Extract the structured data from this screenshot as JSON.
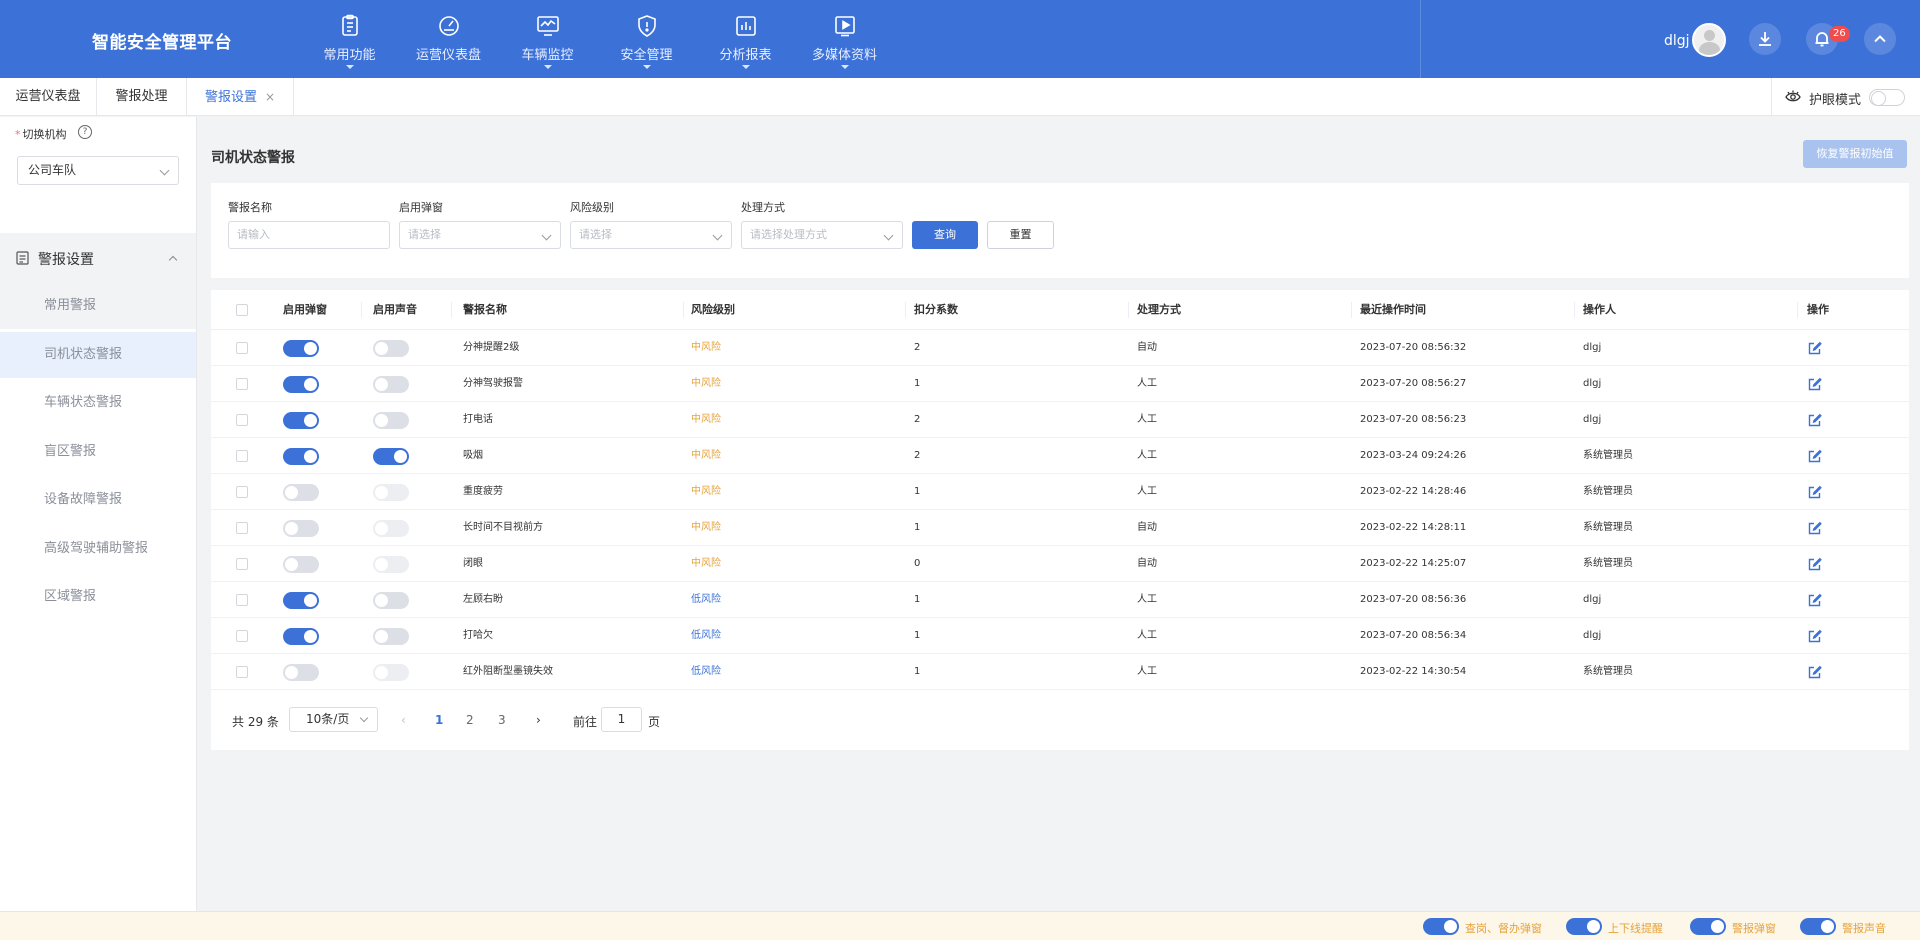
{
  "header": {
    "app_title": "智能安全管理平台",
    "nav": [
      {
        "label": "常用功能",
        "icon": "clipboard-icon",
        "caret": true
      },
      {
        "label": "运营仪表盘",
        "icon": "gauge-icon",
        "caret": false
      },
      {
        "label": "车辆监控",
        "icon": "monitor-icon",
        "caret": true
      },
      {
        "label": "安全管理",
        "icon": "shield-icon",
        "caret": true
      },
      {
        "label": "分析报表",
        "icon": "bar-chart-icon",
        "caret": true
      },
      {
        "label": "多媒体资料",
        "icon": "play-icon",
        "caret": true
      }
    ],
    "user_name": "dlgj",
    "notification_count": "26",
    "colors": {
      "primary": "#3c72d8"
    }
  },
  "tabs": [
    {
      "label": "运营仪表盘"
    },
    {
      "label": "警报处理"
    },
    {
      "label": "警报设置",
      "active": true,
      "close": "×"
    }
  ],
  "eye_mode": {
    "label": "护眼模式",
    "on": false
  },
  "sidebar": {
    "org_label": "切换机构",
    "org_required": "*",
    "help": "?",
    "org_value": "公司车队",
    "group_label": "警报设置",
    "items": [
      {
        "label": "常用警报"
      },
      {
        "label": "司机状态警报"
      },
      {
        "label": "车辆状态警报"
      },
      {
        "label": "盲区警报"
      },
      {
        "label": "设备故障警报"
      },
      {
        "label": "高级驾驶辅助警报"
      },
      {
        "label": "区域警报"
      }
    ]
  },
  "page": {
    "title": "司机状态警报",
    "restore_button": "恢复警报初始值"
  },
  "filters": {
    "fields": [
      {
        "label": "警报名称",
        "placeholder": "请输入"
      },
      {
        "label": "启用弹窗",
        "placeholder": "请选择"
      },
      {
        "label": "风险级别",
        "placeholder": "请选择"
      },
      {
        "label": "处理方式",
        "placeholder": "请选择处理方式"
      }
    ],
    "query_button": "查询",
    "reset_button": "重置"
  },
  "table": {
    "headers": [
      "启用弹窗",
      "启用声音",
      "警报名称",
      "风险级别",
      "扣分系数",
      "处理方式",
      "最近操作时间",
      "操作人",
      "操作"
    ],
    "rows": [
      {
        "popup": "on",
        "sound": "off",
        "name": "分神提醒2级",
        "risk": "中风险",
        "risk_level": "mid",
        "coef": "2",
        "method": "自动",
        "time": "2023-07-20 08:56:32",
        "operator": "dlgj"
      },
      {
        "popup": "on",
        "sound": "off",
        "name": "分神驾驶报警",
        "risk": "中风险",
        "risk_level": "mid",
        "coef": "1",
        "method": "人工",
        "time": "2023-07-20 08:56:27",
        "operator": "dlgj"
      },
      {
        "popup": "on",
        "sound": "off",
        "name": "打电话",
        "risk": "中风险",
        "risk_level": "mid",
        "coef": "2",
        "method": "人工",
        "time": "2023-07-20 08:56:23",
        "operator": "dlgj"
      },
      {
        "popup": "on",
        "sound": "on",
        "name": "吸烟",
        "risk": "中风险",
        "risk_level": "mid",
        "coef": "2",
        "method": "人工",
        "time": "2023-03-24 09:24:26",
        "operator": "系统管理员"
      },
      {
        "popup": "off",
        "sound": "dis",
        "name": "重度疲劳",
        "risk": "中风险",
        "risk_level": "mid",
        "coef": "1",
        "method": "人工",
        "time": "2023-02-22 14:28:46",
        "operator": "系统管理员"
      },
      {
        "popup": "off",
        "sound": "dis",
        "name": "长时间不目视前方",
        "risk": "中风险",
        "risk_level": "mid",
        "coef": "1",
        "method": "自动",
        "time": "2023-02-22 14:28:11",
        "operator": "系统管理员"
      },
      {
        "popup": "off",
        "sound": "dis",
        "name": "闭眼",
        "risk": "中风险",
        "risk_level": "mid",
        "coef": "0",
        "method": "自动",
        "time": "2023-02-22 14:25:07",
        "operator": "系统管理员"
      },
      {
        "popup": "on",
        "sound": "off",
        "name": "左顾右盼",
        "risk": "低风险",
        "risk_level": "low",
        "coef": "1",
        "method": "人工",
        "time": "2023-07-20 08:56:36",
        "operator": "dlgj"
      },
      {
        "popup": "on",
        "sound": "off",
        "name": "打哈欠",
        "risk": "低风险",
        "risk_level": "low",
        "coef": "1",
        "method": "人工",
        "time": "2023-07-20 08:56:34",
        "operator": "dlgj"
      },
      {
        "popup": "off",
        "sound": "dis",
        "name": "红外阻断型墨镜失效",
        "risk": "低风险",
        "risk_level": "low",
        "coef": "1",
        "method": "人工",
        "time": "2023-02-22 14:30:54",
        "operator": "系统管理员"
      }
    ]
  },
  "pagination": {
    "total": "共 29 条",
    "page_size": "10条/页",
    "pages": [
      "1",
      "2",
      "3"
    ],
    "current": "1",
    "goto_label": "前往",
    "goto_value": "1",
    "goto_suffix": "页"
  },
  "footer": {
    "toggles": [
      {
        "label": "查岗、督办弹窗",
        "on": true
      },
      {
        "label": "上下线提醒",
        "on": true
      },
      {
        "label": "警报弹窗",
        "on": true
      },
      {
        "label": "警报声音",
        "on": true
      }
    ]
  }
}
